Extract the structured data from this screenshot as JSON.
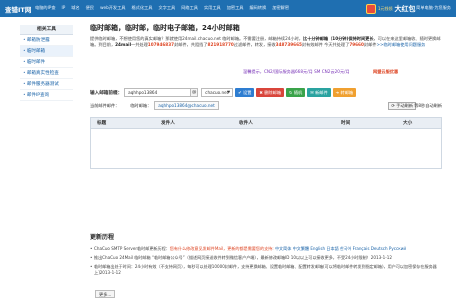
{
  "header": {
    "logo": "查错IT网",
    "nav": [
      "电脑的IP查",
      "IP",
      "域名",
      "便民",
      "web开发工具",
      "格式化工具",
      "文字工具",
      "网络工具",
      "实用工具",
      "加密工具",
      "编码转换",
      "加密解密"
    ],
    "promo_small": "1元钱领",
    "promo_big": "大红包",
    "right_link": "简单电脑·为您服务"
  },
  "sidebar": {
    "title": "相关工具",
    "items": [
      "邮箱防泄露",
      "临时邮箱",
      "临时邮件",
      "邮箱真实性检查",
      "邮件服务器测试",
      "邮件IP查询"
    ]
  },
  "main": {
    "title": "临时邮箱，临时邮，临时电子邮箱，24小时邮箱",
    "desc_1": "提供临时邮箱，不想使用您的真实邮箱？那就使用24mail.chacuo.net 临时邮箱。不需要注册，邮箱持续24小时，",
    "desc_1_bold": "比十分钟邮箱（10分钟)保持时间更长",
    "desc_2": "，可以在来这里邮箱收、随时更换邮箱。到目前，",
    "desc_2_bold": "24mail",
    "desc_3": "一共处理",
    "count_1": "107946837",
    "desc_4": "封邮件，共阻挡了",
    "count_2": "821918770",
    "desc_5": "过滤邮件，转发，接收",
    "count_3": "348739665",
    "desc_6": "封有效邮件 今天共处理了",
    "count_4": "79660",
    "desc_7": "封邮件",
    "link": ">>临时邮箱使用问题服务",
    "notice_1": "温馨提示，CN2/国际服务器668元/月 SM CN2云20元/月",
    "notice_2": "网盟云服优惠"
  },
  "toolbar": {
    "label": "输入邮箱前缀：",
    "value": "aqhhpo13864",
    "at": "@",
    "domain": "chacuo.net",
    "btn_set": "设置",
    "btn_delete": "删除邮箱",
    "btn_random": "随机",
    "btn_new": "新邮件",
    "btn_extra": "转邮箱"
  },
  "current": {
    "label": "当前邮件邮件：",
    "label2": "临时邮箱：",
    "address": "aqhhpo13864@chacuo.net",
    "refresh": "手动刷新",
    "autoref": "等8秒自动刷新"
  },
  "table": {
    "headers": [
      "标题",
      "发件人",
      "收件人",
      "时间",
      "大小"
    ]
  },
  "updates": {
    "title": "更新历程",
    "item1_a": "ChaCuo SMTP Server临时邮更新历程：",
    "item1_red": "您有什么修改意见发邮件Mail，更新的都是需要您的支持:",
    "item1_langs": "中文简体  中文繁體  English  日本語  한국어  Français  Deutsch  Русский",
    "item2": "推出ChaCuo 24Mail 临时邮箱 “临时邮箱公众号”（描述网页接送收件转到微信客户户端），最新修改邮箱ID 10以以上可以接收更多，不受24小时限制！2013-1-12",
    "item3": "临时邮箱出处于时间：24小时有效（不支持网页），每秒可以处理10000封邮件，支持更换邮箱、设置临时邮箱、配置转发邮箱(可以将临时邮件转发到指定邮箱)，用户可以加密保存在服务器上]2013-1-12",
    "more": "更多..."
  },
  "colors": {
    "header_bg": "#1f6fb1",
    "accent_blue": "#2e7dd1",
    "accent_red": "#d9453b"
  }
}
